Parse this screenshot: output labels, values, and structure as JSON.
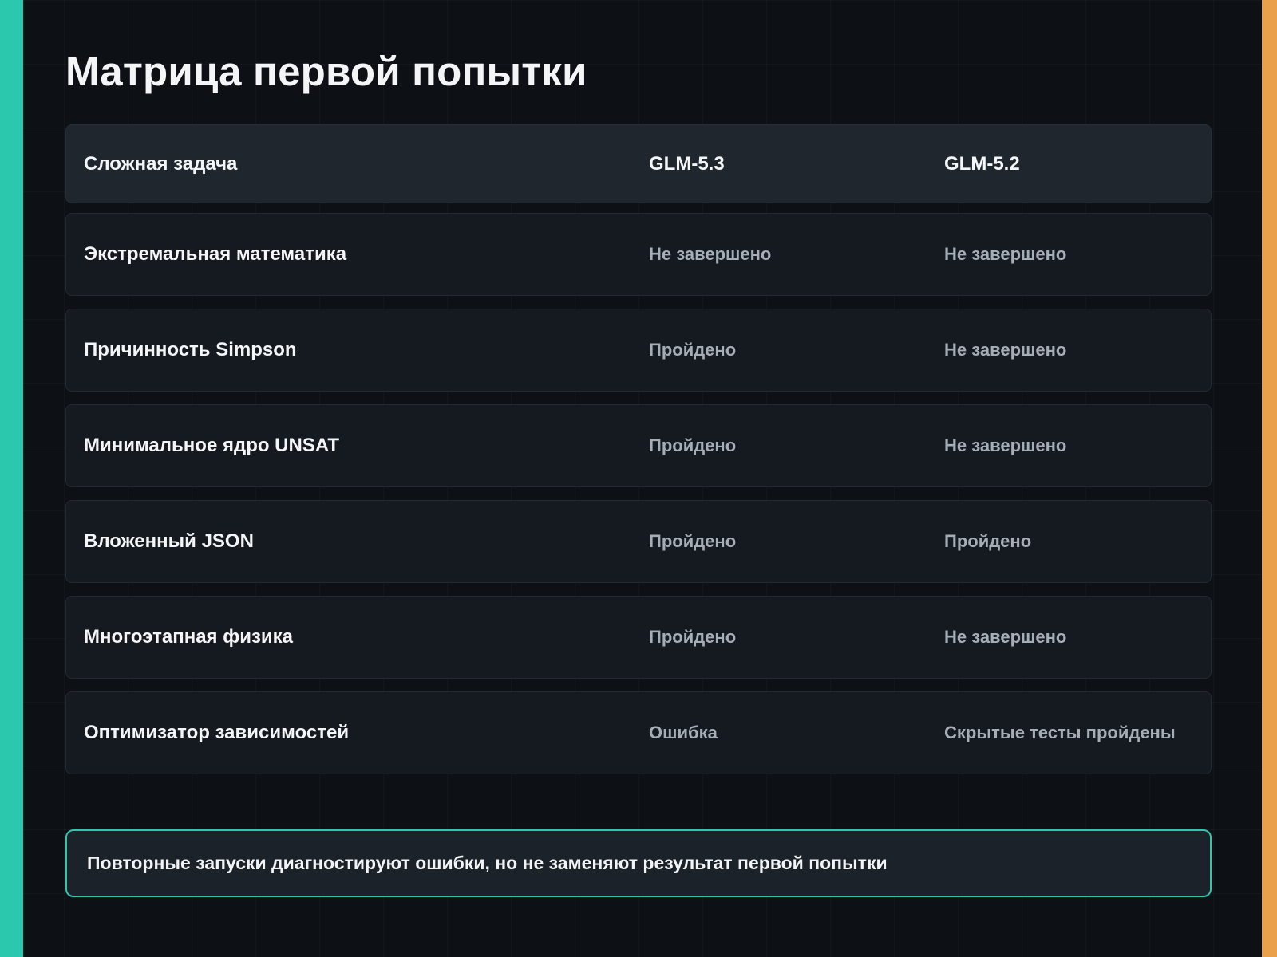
{
  "colors": {
    "accent_left": "#2bc8ae",
    "accent_right": "#e9a04a",
    "background": "#0d1014",
    "note_border": "#2bc8ae"
  },
  "title": "Матрица первой попытки",
  "table": {
    "headers": [
      "Сложная задача",
      "GLM-5.3",
      "GLM-5.2"
    ],
    "rows": [
      [
        "Экстремальная математика",
        "Не завершено",
        "Не завершено"
      ],
      [
        "Причинность Simpson",
        "Пройдено",
        "Не завершено"
      ],
      [
        "Минимальное ядро UNSAT",
        "Пройдено",
        "Не завершено"
      ],
      [
        "Вложенный JSON",
        "Пройдено",
        "Пройдено"
      ],
      [
        "Многоэтапная физика",
        "Пройдено",
        "Не завершено"
      ],
      [
        "Оптимизатор зависимостей",
        "Ошибка",
        "Скрытые тесты пройдены"
      ]
    ]
  },
  "note": "Повторные запуски диагностируют ошибки, но не заменяют результат первой попытки"
}
